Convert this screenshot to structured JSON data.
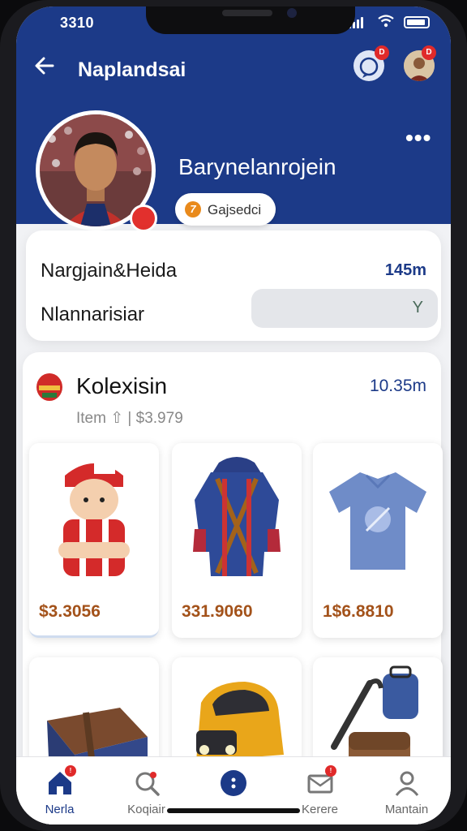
{
  "status": {
    "time": "3310"
  },
  "header": {
    "title": "Naplandsai",
    "msg_badge": "D",
    "user_badge": "D"
  },
  "profile": {
    "username": "Barynelanrojein",
    "pill_coin": "7",
    "pill_label": "Gajsedci"
  },
  "info": {
    "row1_label": "Nargjain&Heida",
    "row1_value": "145m",
    "row2_label": "Nlannarisiar",
    "select_chevron": "Y"
  },
  "collection": {
    "title": "Kolexisin",
    "value": "10.35m",
    "subtitle": "Item ⇧ | $3.979",
    "items": [
      {
        "price": "$3.3056",
        "icon": "figurine-icon"
      },
      {
        "price": "331.9060",
        "icon": "jacket-icon"
      },
      {
        "price": "1$6.8810",
        "icon": "tshirt-icon"
      },
      {
        "price": "",
        "icon": "pouch-icon"
      },
      {
        "price": "",
        "icon": "toy-car-icon"
      },
      {
        "price": "",
        "icon": "bag-icon"
      }
    ]
  },
  "tabs": [
    {
      "label": "Nerla",
      "icon": "home-icon",
      "badge": "!"
    },
    {
      "label": "Koqiair",
      "icon": "search-icon",
      "badge": ""
    },
    {
      "label": "",
      "icon": "center-icon",
      "badge": ""
    },
    {
      "label": "Kerere",
      "icon": "mail-icon",
      "badge": "!"
    },
    {
      "label": "Mantain",
      "icon": "profile-icon",
      "badge": ""
    }
  ],
  "colors": {
    "primary": "#1c3a88",
    "accent": "#e02a2a",
    "price": "#a3521a"
  }
}
